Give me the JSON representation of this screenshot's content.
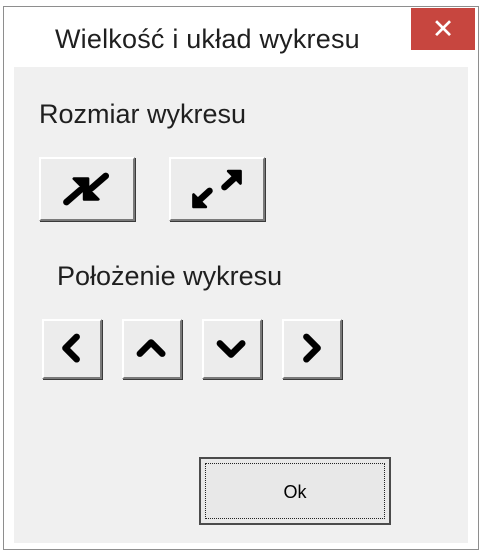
{
  "window": {
    "title": "Wielkość i układ wykresu",
    "close_glyph": "✕"
  },
  "size_section": {
    "label": "Rozmiar wykresu",
    "buttons": [
      {
        "icon": "shrink-arrows-icon"
      },
      {
        "icon": "expand-arrows-icon"
      }
    ]
  },
  "position_section": {
    "label": "Położenie wykresu",
    "buttons": [
      {
        "icon": "chevron-left-icon"
      },
      {
        "icon": "chevron-up-icon"
      },
      {
        "icon": "chevron-down-icon"
      },
      {
        "icon": "chevron-right-icon"
      }
    ]
  },
  "ok_button": {
    "label": "Ok"
  },
  "colors": {
    "close_button": "#c7463f",
    "client_background": "#f0f0f0",
    "button_face": "#ececec"
  }
}
